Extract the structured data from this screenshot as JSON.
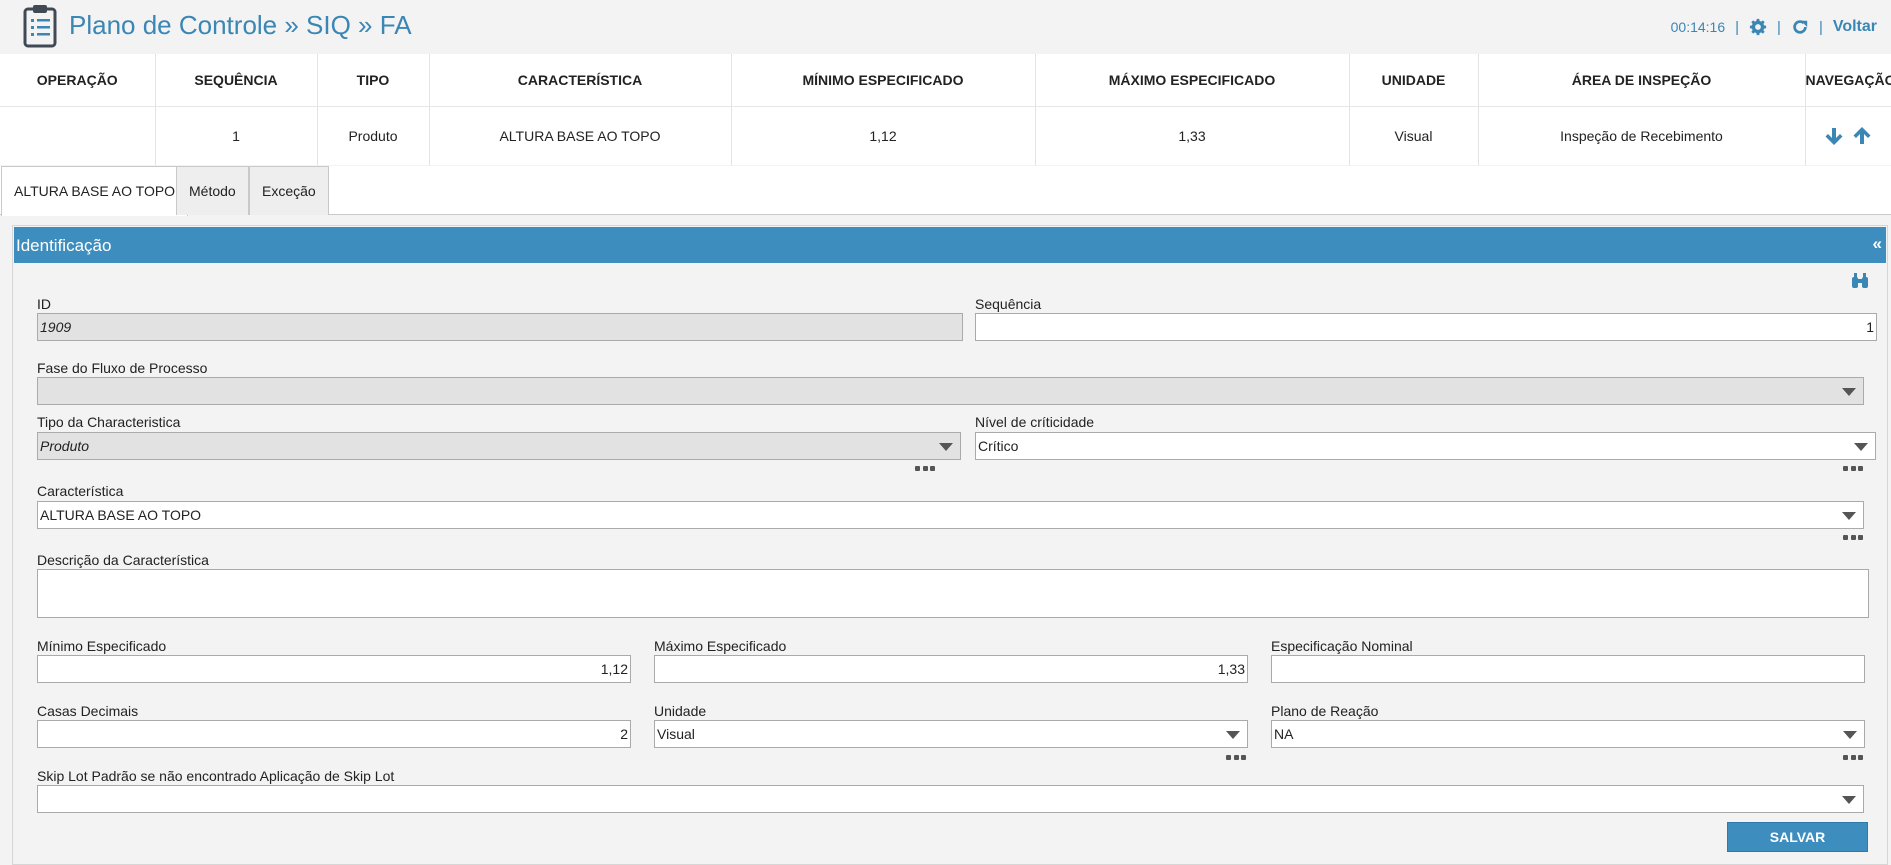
{
  "header": {
    "title": "Plano de Controle » SIQ » FA",
    "clock": "00:14:16",
    "separator": "|",
    "back_label": "Voltar",
    "icons": [
      "clipboard-icon",
      "gear-icon",
      "refresh-icon"
    ],
    "accent_color": "#3a86b4"
  },
  "table": {
    "columns": [
      "OPERAÇÃO",
      "SEQUÊNCIA",
      "TIPO",
      "CARACTERÍSTICA",
      "MÍNIMO ESPECIFICADO",
      "MÁXIMO ESPECIFICADO",
      "UNIDADE",
      "ÁREA DE INSPEÇÃO",
      "NAVEGAÇÃO"
    ],
    "rows": [
      {
        "operacao": "",
        "sequencia": "1",
        "tipo": "Produto",
        "caracteristica": "ALTURA BASE AO TOPO",
        "minimo": "1,12",
        "maximo": "1,33",
        "unidade": "Visual",
        "area": "Inspeção de Recebimento",
        "nav_icons": [
          "arrow-down-icon",
          "arrow-up-icon"
        ]
      }
    ]
  },
  "tabs": [
    {
      "label": "ALTURA BASE AO TOPO",
      "active": true
    },
    {
      "label": "Método",
      "active": false
    },
    {
      "label": "Exceção",
      "active": false
    }
  ],
  "panel": {
    "title": "Identificação",
    "collapse_glyph": "«",
    "header_color": "#3d8ebe",
    "fields": {
      "id": {
        "label": "ID",
        "value": "1909"
      },
      "sequencia": {
        "label": "Sequência",
        "value": "1"
      },
      "fase": {
        "label": "Fase do Fluxo de Processo",
        "value": ""
      },
      "tipo_carac": {
        "label": "Tipo da Characteristica",
        "value": "Produto"
      },
      "nivel": {
        "label": "Nível de críticidade",
        "value": "Crítico"
      },
      "caracteristica": {
        "label": "Característica",
        "value": "ALTURA BASE AO TOPO"
      },
      "descricao": {
        "label": "Descrição da Característica",
        "value": ""
      },
      "minimo": {
        "label": "Mínimo Especificado",
        "value": "1,12"
      },
      "maximo": {
        "label": "Máximo Especificado",
        "value": "1,33"
      },
      "nominal": {
        "label": "Especificação Nominal",
        "value": ""
      },
      "casas": {
        "label": "Casas Decimais",
        "value": "2"
      },
      "unidade": {
        "label": "Unidade",
        "value": "Visual"
      },
      "plano": {
        "label": "Plano de Reação",
        "value": "NA"
      },
      "skiplot": {
        "label": "Skip Lot Padrão se não encontrado Aplicação de Skip Lot",
        "value": ""
      }
    },
    "save_label": "SALVAR"
  }
}
